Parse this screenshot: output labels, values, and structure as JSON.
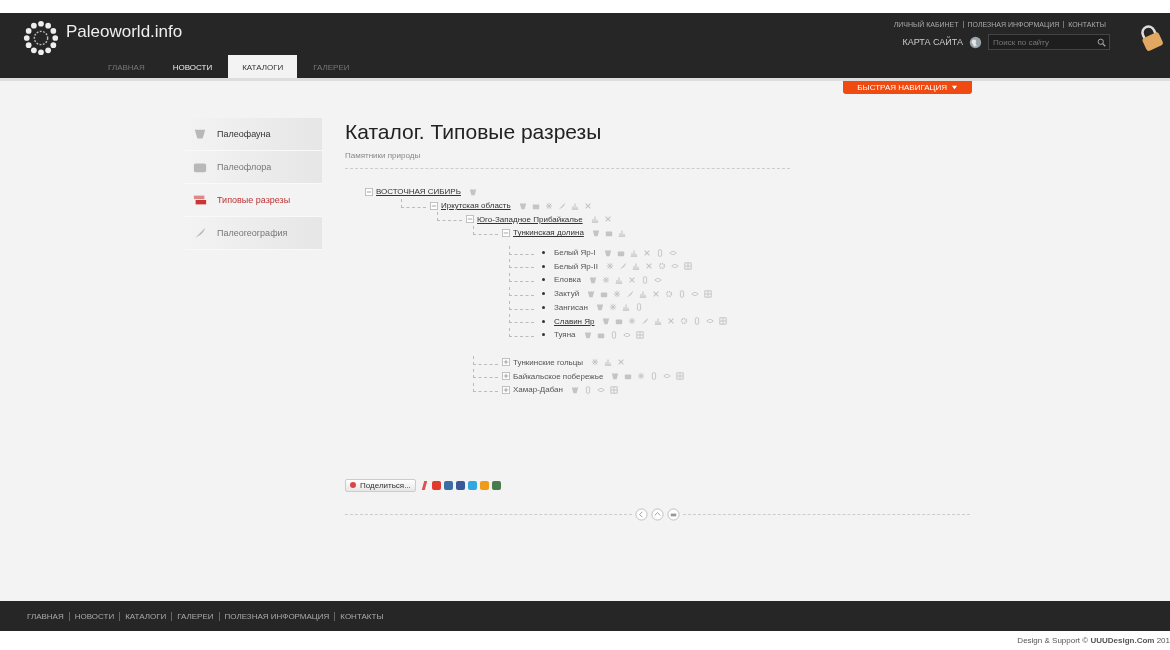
{
  "header": {
    "logo": "Paleoworld.info",
    "nav": [
      {
        "label": "ГЛАВНАЯ",
        "selected": false
      },
      {
        "label": "НОВОСТИ",
        "selected": false
      },
      {
        "label": "КАТАЛОГИ",
        "selected": true
      },
      {
        "label": "ГАЛЕРЕИ",
        "selected": false
      }
    ],
    "top_links": [
      "ЛИЧНЫЙ КАБИНЕТ",
      "ПОЛЕЗНАЯ ИНФОРМАЦИЯ",
      "КОНТАКТЫ"
    ],
    "sitemap": "КАРТА САЙТА",
    "search": {
      "placeholder": "Поиск по сайту"
    },
    "quick_nav": "БЫСТРАЯ НАВИГАЦИЯ"
  },
  "sidebar": {
    "items": [
      {
        "label": "Палеофауна",
        "selected": false
      },
      {
        "label": "Палеофлора",
        "selected": false
      },
      {
        "label": "Типовые разрезы",
        "selected": true
      },
      {
        "label": "Палеогеография",
        "selected": false
      }
    ]
  },
  "main": {
    "title": "Каталог. Типовые разрезы",
    "breadcrumb": "Памятники природы",
    "tree": [
      {
        "kind": "group",
        "label": "ВОСТОЧНАЯ СИБИРЬ",
        "linked": true,
        "expanded": true,
        "tools": [
          {
            "kind": "shell"
          }
        ],
        "children": [
          {
            "kind": "group",
            "label": "Иркутская область",
            "linked": true,
            "expanded": true,
            "tools": [
              {
                "kind": "shell"
              },
              {
                "kind": "case"
              },
              {
                "kind": "star"
              },
              {
                "kind": "feather"
              },
              {
                "kind": "bars"
              },
              {
                "kind": "cross"
              }
            ],
            "children": [
              {
                "kind": "group",
                "label": "Юго-Западное Прибайкалье",
                "linked": true,
                "expanded": true,
                "tools": [
                  {
                    "kind": "bars"
                  },
                  {
                    "kind": "cross"
                  }
                ],
                "children": [
                  {
                    "kind": "group",
                    "label": "Тункинская долина",
                    "linked": true,
                    "expanded": true,
                    "tools": [
                      {
                        "kind": "shell"
                      },
                      {
                        "kind": "case"
                      },
                      {
                        "kind": "bars"
                      }
                    ],
                    "children": [
                      {
                        "kind": "leaf",
                        "label": "Белый Яр-I",
                        "linked": false,
                        "tools": [
                          {
                            "kind": "shell"
                          },
                          {
                            "kind": "case"
                          },
                          {
                            "kind": "bars"
                          },
                          {
                            "kind": "cross"
                          },
                          {
                            "kind": "phone"
                          },
                          {
                            "kind": "eye"
                          }
                        ]
                      },
                      {
                        "kind": "leaf",
                        "label": "Белый Яр-II",
                        "linked": false,
                        "tools": [
                          {
                            "kind": "star"
                          },
                          {
                            "kind": "feather"
                          },
                          {
                            "kind": "bars"
                          },
                          {
                            "kind": "cross"
                          },
                          {
                            "kind": "gear"
                          },
                          {
                            "kind": "eye"
                          },
                          {
                            "kind": "grid"
                          }
                        ]
                      },
                      {
                        "kind": "leaf",
                        "label": "Еловка",
                        "linked": false,
                        "tools": [
                          {
                            "kind": "shell"
                          },
                          {
                            "kind": "star"
                          },
                          {
                            "kind": "bars"
                          },
                          {
                            "kind": "cross"
                          },
                          {
                            "kind": "phone"
                          },
                          {
                            "kind": "eye"
                          }
                        ]
                      },
                      {
                        "kind": "leaf",
                        "label": "Зактуй",
                        "linked": false,
                        "tools": [
                          {
                            "kind": "shell"
                          },
                          {
                            "kind": "case"
                          },
                          {
                            "kind": "star"
                          },
                          {
                            "kind": "feather"
                          },
                          {
                            "kind": "bars"
                          },
                          {
                            "kind": "cross"
                          },
                          {
                            "kind": "gear"
                          },
                          {
                            "kind": "phone"
                          },
                          {
                            "kind": "eye"
                          },
                          {
                            "kind": "grid"
                          }
                        ]
                      },
                      {
                        "kind": "leaf",
                        "label": "Зангисан",
                        "linked": false,
                        "tools": [
                          {
                            "kind": "shell"
                          },
                          {
                            "kind": "star"
                          },
                          {
                            "kind": "bars"
                          },
                          {
                            "kind": "phone"
                          }
                        ]
                      },
                      {
                        "kind": "leaf",
                        "label": "Славин Яр",
                        "linked": true,
                        "tools": [
                          {
                            "kind": "shell"
                          },
                          {
                            "kind": "case"
                          },
                          {
                            "kind": "star"
                          },
                          {
                            "kind": "feather"
                          },
                          {
                            "kind": "bars"
                          },
                          {
                            "kind": "cross"
                          },
                          {
                            "kind": "gear"
                          },
                          {
                            "kind": "phone"
                          },
                          {
                            "kind": "eye"
                          },
                          {
                            "kind": "grid"
                          }
                        ]
                      },
                      {
                        "kind": "leaf",
                        "label": "Туяна",
                        "linked": false,
                        "tools": [
                          {
                            "kind": "shell"
                          },
                          {
                            "kind": "case"
                          },
                          {
                            "kind": "phone"
                          },
                          {
                            "kind": "eye"
                          },
                          {
                            "kind": "grid"
                          }
                        ]
                      }
                    ]
                  },
                  {
                    "kind": "group",
                    "label": "Тункинские гольцы",
                    "linked": false,
                    "expanded": false,
                    "tools": [
                      {
                        "kind": "star"
                      },
                      {
                        "kind": "bars"
                      },
                      {
                        "kind": "cross"
                      }
                    ]
                  },
                  {
                    "kind": "group",
                    "label": "Байкальское побережье",
                    "linked": false,
                    "expanded": false,
                    "tools": [
                      {
                        "kind": "shell"
                      },
                      {
                        "kind": "case"
                      },
                      {
                        "kind": "star"
                      },
                      {
                        "kind": "phone"
                      },
                      {
                        "kind": "eye"
                      },
                      {
                        "kind": "grid"
                      }
                    ]
                  },
                  {
                    "kind": "group",
                    "label": "Хамар-Дабан",
                    "linked": false,
                    "expanded": false,
                    "tools": [
                      {
                        "kind": "shell"
                      },
                      {
                        "kind": "phone"
                      },
                      {
                        "kind": "eye"
                      },
                      {
                        "kind": "grid"
                      }
                    ]
                  }
                ]
              }
            ]
          }
        ]
      }
    ],
    "share": {
      "label": "Поделиться...",
      "services": [
        {
          "color": "#e23a2e"
        },
        {
          "color": "#3a6ea5"
        },
        {
          "color": "#3b5998"
        },
        {
          "color": "#2fa8e0"
        },
        {
          "color": "#f09a1a"
        },
        {
          "color": "#4a7a50"
        }
      ]
    }
  },
  "footer": {
    "links": [
      "ГЛАВНАЯ",
      "НОВОСТИ",
      "КАТАЛОГИ",
      "ГАЛЕРЕИ",
      "ПОЛЕЗНАЯ ИНФОРМАЦИЯ",
      "КОНТАКТЫ"
    ],
    "credit": "Design & Support © **UUUDesign.Com** 201"
  }
}
